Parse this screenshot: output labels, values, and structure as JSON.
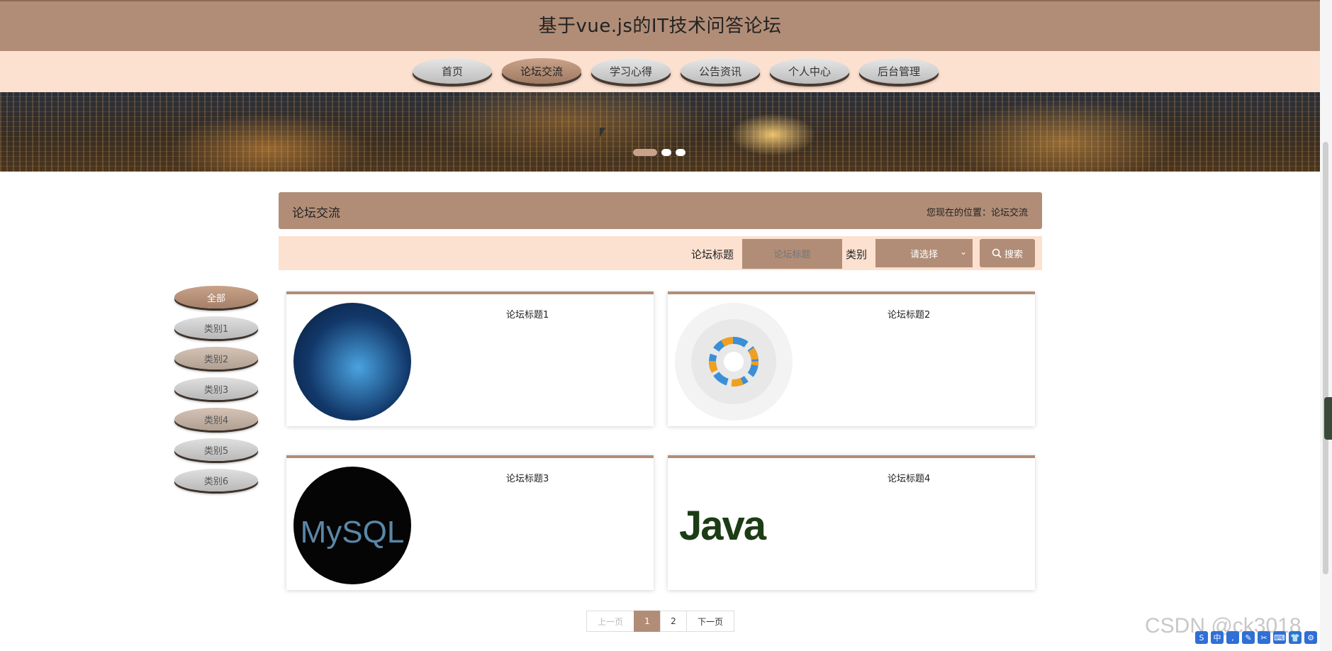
{
  "header": {
    "title": "基于vue.js的IT技术问答论坛"
  },
  "nav": {
    "items": [
      "首页",
      "论坛交流",
      "学习心得",
      "公告资讯",
      "个人中心",
      "后台管理"
    ]
  },
  "section": {
    "title": "论坛交流",
    "location": "您现在的位置：论坛交流"
  },
  "search": {
    "title_label": "论坛标题",
    "title_placeholder": "论坛标题",
    "category_label": "类别",
    "category_value": "请选择",
    "button_label": "搜索"
  },
  "categories": [
    "全部",
    "类别1",
    "类别2",
    "类别3",
    "类别4",
    "类别5",
    "类别6"
  ],
  "cards": [
    {
      "title": "论坛标题1"
    },
    {
      "title": "论坛标题2"
    },
    {
      "title": "论坛标题3"
    },
    {
      "title": "论坛标题4"
    }
  ],
  "card_images": {
    "mysql_text": "MySQL",
    "java_text": "Java"
  },
  "pager": {
    "prev": "上一页",
    "pages": [
      "1",
      "2"
    ],
    "next": "下一页"
  },
  "watermark": "CSDN @ck3018",
  "colors": {
    "accent": "#b18d77",
    "light": "#fde1d0"
  }
}
